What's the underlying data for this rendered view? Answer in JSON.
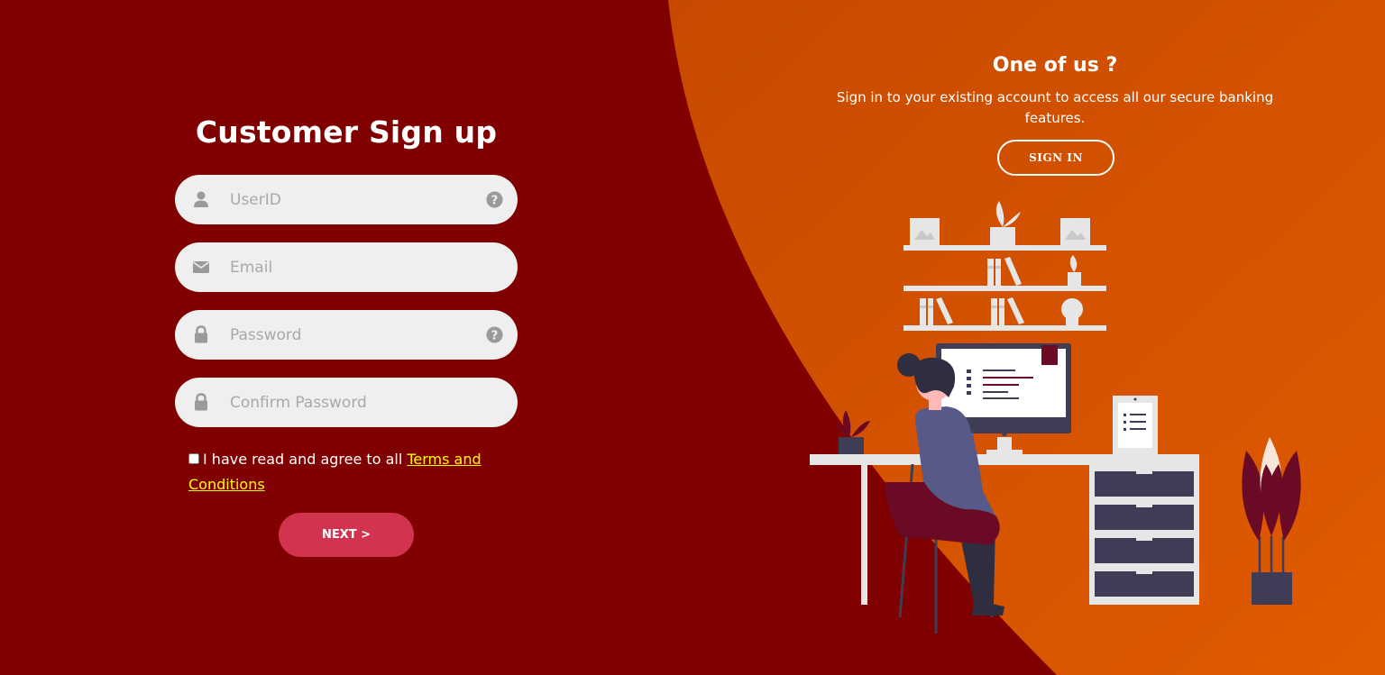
{
  "colors": {
    "left_background": "#800000",
    "right_background": "#cc5200",
    "accent_button": "#d2334f",
    "link": "#ffff00",
    "input_background": "#efefef"
  },
  "signup": {
    "title": "Customer Sign up",
    "fields": [
      {
        "name": "userid",
        "placeholder": "UserID",
        "icon": "user-icon",
        "help_icon": "question-circle-icon"
      },
      {
        "name": "email",
        "placeholder": "Email",
        "icon": "envelope-icon"
      },
      {
        "name": "password",
        "placeholder": "Password",
        "icon": "lock-icon",
        "help_icon": "question-circle-icon"
      },
      {
        "name": "confirm_password",
        "placeholder": "Confirm Password",
        "icon": "lock-icon"
      }
    ],
    "terms_text": "I have read and agree to all ",
    "terms_link": "Terms and Conditions",
    "next_label": "NEXT >"
  },
  "panel": {
    "title": "One of us ?",
    "text": "Sign in to your existing account to access all our secure banking features.",
    "signin_label": "SIGN IN",
    "illustration": "woman-working-at-desk-illustration"
  }
}
